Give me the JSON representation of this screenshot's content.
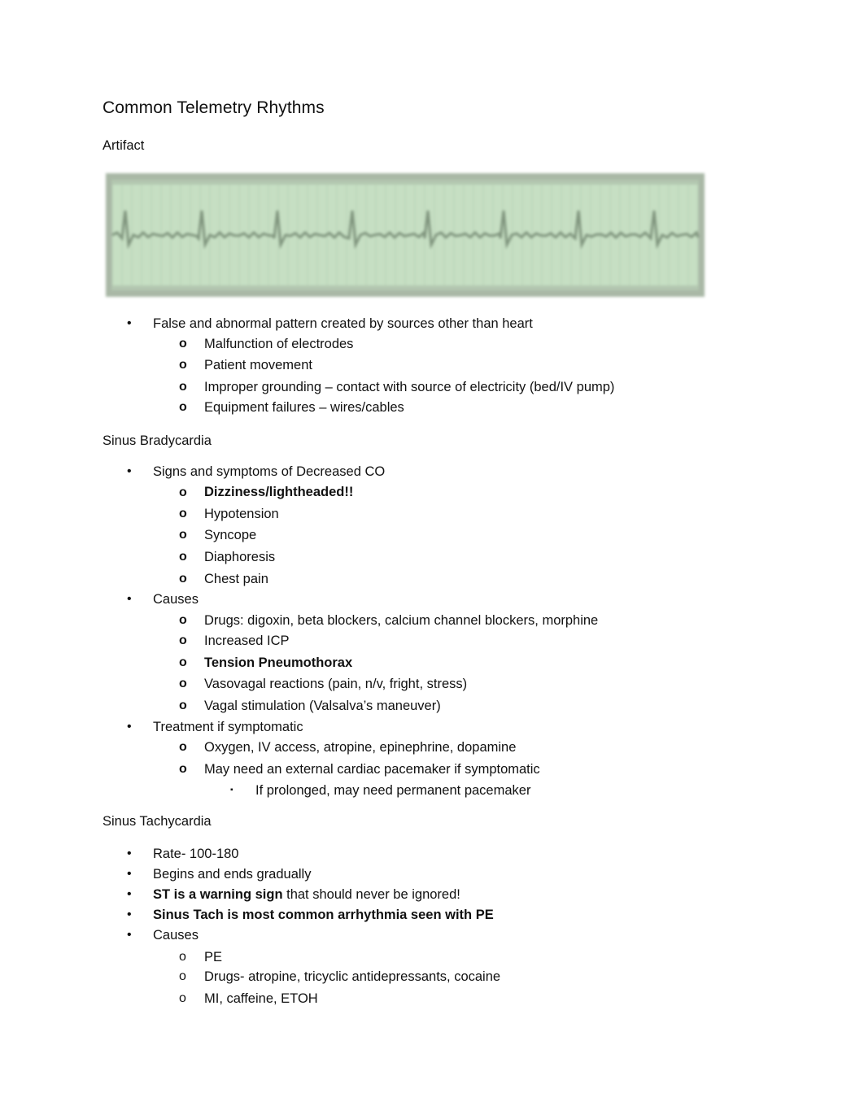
{
  "document": {
    "title": "Common Telemetry Rhythms",
    "sections": [
      {
        "heading": "Artifact",
        "image": {
          "semantic": "ecg-rhythm-strip-artifact",
          "background_color": "#c6dfc3",
          "trace_color": "#7b8f79"
        },
        "items": [
          {
            "text": "False and abnormal pattern created by sources other than heart",
            "children": [
              {
                "text": "Malfunction of electrodes"
              },
              {
                "text": "Patient movement"
              },
              {
                "text": "Improper grounding – contact with source of electricity (bed/IV pump)"
              },
              {
                "text": "Equipment failures – wires/cables"
              }
            ]
          }
        ]
      },
      {
        "heading": "Sinus Bradycardia",
        "items": [
          {
            "text": "Signs and symptoms of Decreased CO",
            "children": [
              {
                "text": "Dizziness/lightheaded!!",
                "bold": true
              },
              {
                "text": "Hypotension"
              },
              {
                "text": "Syncope"
              },
              {
                "text": "Diaphoresis"
              },
              {
                "text": "Chest pain"
              }
            ]
          },
          {
            "text": "Causes",
            "children": [
              {
                "text": "Drugs: digoxin, beta blockers, calcium channel blockers, morphine"
              },
              {
                "text": "Increased ICP"
              },
              {
                "text": "Tension Pneumothorax",
                "bold": true
              },
              {
                "text": "Vasovagal reactions (pain, n/v, fright, stress)"
              },
              {
                "text": "Vagal stimulation (Valsalva’s maneuver)"
              }
            ]
          },
          {
            "text": "Treatment if symptomatic",
            "children": [
              {
                "text": "Oxygen, IV access, atropine, epinephrine, dopamine"
              },
              {
                "text": "May need an external cardiac pacemaker if symptomatic",
                "children": [
                  {
                    "text": "If prolonged, may need permanent pacemaker"
                  }
                ]
              }
            ]
          }
        ]
      },
      {
        "heading": "Sinus Tachycardia",
        "items": [
          {
            "text": "Rate- 100-180"
          },
          {
            "text": "Begins and ends gradually"
          },
          {
            "bold_part": "ST is a warning sign",
            "text": " that should never be ignored!"
          },
          {
            "text": "Sinus Tach is most common arrhythmia seen with PE",
            "bold": true
          },
          {
            "text": "Causes",
            "children": [
              {
                "text": "PE"
              },
              {
                "text": "Drugs- atropine, tricyclic antidepressants, cocaine"
              },
              {
                "text": "MI, caffeine, ETOH"
              }
            ]
          }
        ]
      }
    ],
    "bullets": {
      "level1": "•",
      "level2": "o",
      "level3": "▪"
    }
  }
}
